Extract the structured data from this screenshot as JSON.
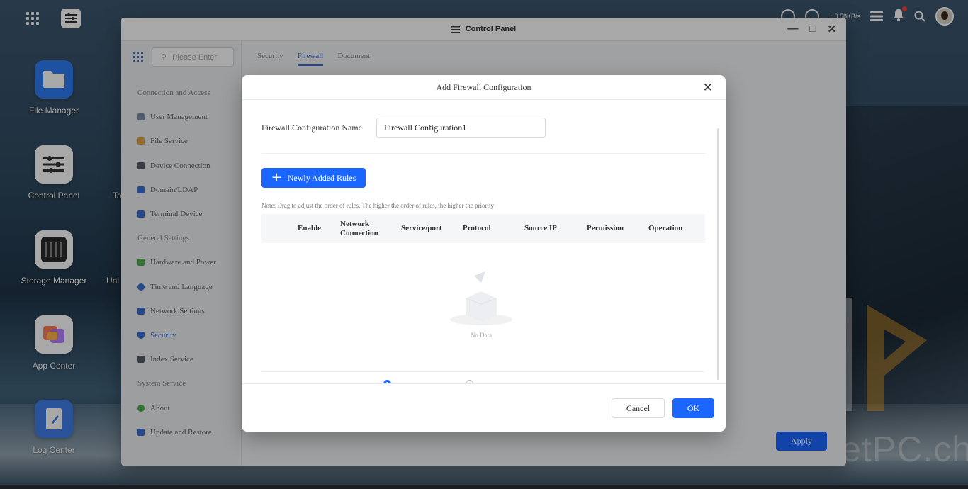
{
  "desktop": {
    "icons": [
      {
        "label": "File Manager"
      },
      {
        "label": "Control Panel"
      },
      {
        "label": "Storage Manager"
      },
      {
        "label": "App Center"
      },
      {
        "label": "Log Center"
      }
    ],
    "cut_labels": [
      "Ta",
      "Uni"
    ],
    "watermark": "PocketPC.ch"
  },
  "topbar": {
    "net_speed": "↑ 0.58KB/s"
  },
  "window": {
    "title": "Control Panel",
    "search_placeholder": "Please Enter",
    "sidebar": [
      {
        "type": "group",
        "label": "Connection and Access"
      },
      {
        "type": "item",
        "label": "User Management",
        "color": "#7d8ea8"
      },
      {
        "type": "item",
        "label": "File Service",
        "color": "#e8a23c"
      },
      {
        "type": "item",
        "label": "Device Connection",
        "color": "#555d66"
      },
      {
        "type": "item",
        "label": "Domain/LDAP",
        "color": "#3a6fd8"
      },
      {
        "type": "item",
        "label": "Terminal Device",
        "color": "#3a6fd8"
      },
      {
        "type": "group",
        "label": "General Settings"
      },
      {
        "type": "item",
        "label": "Hardware and Power",
        "color": "#4caf50"
      },
      {
        "type": "item",
        "label": "Time and Language",
        "color": "#3a6fd8"
      },
      {
        "type": "item",
        "label": "Network Settings",
        "color": "#3a6fd8"
      },
      {
        "type": "item",
        "label": "Security",
        "color": "#3a6fd8",
        "active": true
      },
      {
        "type": "item",
        "label": "Index Service",
        "color": "#555d66"
      },
      {
        "type": "group",
        "label": "System Service"
      },
      {
        "type": "item",
        "label": "About",
        "color": "#4caf50"
      },
      {
        "type": "item",
        "label": "Update and Restore",
        "color": "#3a6fd8"
      }
    ],
    "tabs": [
      {
        "label": "Security",
        "active": false
      },
      {
        "label": "Firewall",
        "active": true
      },
      {
        "label": "Document",
        "active": false
      }
    ],
    "apply_label": "Apply"
  },
  "dialog": {
    "title": "Add Firewall Configuration",
    "config_name_label": "Firewall Configuration Name",
    "config_name_value": "Firewall Configuration1",
    "add_rules_label": "Newly Added Rules",
    "note": "Note: Drag to adjust the order of rules. The higher the order of rules, the higher the priority",
    "columns": [
      "Enable",
      "Network Connection",
      "Service/port",
      "Protocol",
      "Source IP",
      "Permission",
      "Operation"
    ],
    "empty_text": "No Data",
    "cancel_label": "Cancel",
    "ok_label": "OK"
  }
}
